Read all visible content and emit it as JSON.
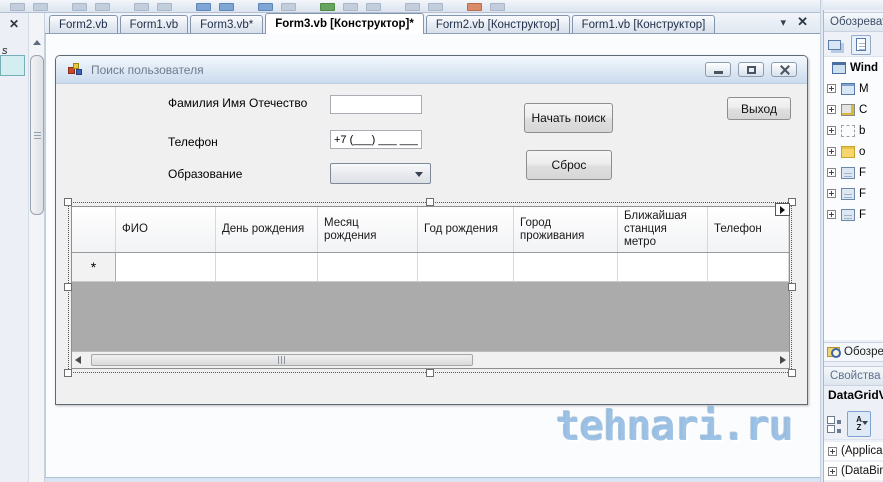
{
  "icons": {
    "chevron_down": "▾",
    "close": "✕"
  },
  "left_strip": {
    "close": "✕",
    "fragment": "s"
  },
  "editor_tabs": {
    "items": [
      {
        "label": "Form2.vb"
      },
      {
        "label": "Form1.vb"
      },
      {
        "label": "Form3.vb*"
      },
      {
        "label": "Form3.vb [Конструктор]*"
      },
      {
        "label": "Form2.vb [Конструктор]"
      },
      {
        "label": "Form1.vb [Конструктор]"
      }
    ]
  },
  "designer_form": {
    "title": "Поиск пользователя",
    "fields": [
      {
        "label": "Фамилия Имя Отечество",
        "value": ""
      },
      {
        "label": "Телефон",
        "value": "+7 (___) ___ ____"
      },
      {
        "label": "Образование",
        "value": ""
      }
    ],
    "buttons": {
      "search": "Начать поиск",
      "reset": "Сброс",
      "exit": "Выход"
    }
  },
  "data_grid": {
    "columns": [
      "ФИО",
      "День рождения",
      "Месяц рождения",
      "Год рождения",
      "Город проживания",
      "Ближайшая станция метро",
      "Телефон"
    ],
    "new_row_marker": "*"
  },
  "solution_explorer": {
    "title": "Обозреват",
    "root_label": "Wind",
    "items": [
      {
        "label": "M"
      },
      {
        "label": "C"
      },
      {
        "label": "b"
      },
      {
        "label": "o"
      },
      {
        "label": "F"
      },
      {
        "label": "F"
      },
      {
        "label": "F"
      }
    ],
    "bottom_tab_label": "Обозре"
  },
  "properties_panel": {
    "title": "Свойства",
    "selected_object": "DataGridV",
    "sort_icon_letters": {
      "a": "A",
      "z": "Z"
    },
    "rows": [
      {
        "label": "(Applica"
      },
      {
        "label": "(DataBin"
      }
    ]
  },
  "watermark": "tehnari.ru"
}
